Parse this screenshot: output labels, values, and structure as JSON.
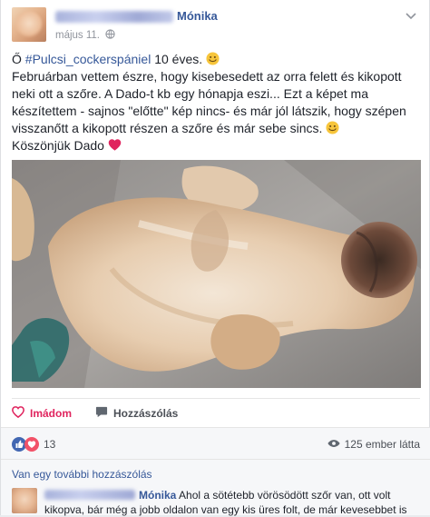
{
  "post": {
    "author": "Mónika",
    "date": "május 11.",
    "text": {
      "prefix": "Ő ",
      "hashtag": "#Pulcsi_cockerspániel",
      "after_hashtag": " 10 éves. ",
      "body": "Februárban vettem észre, hogy kisebesedett az orra felett és kikopott neki ott a szőre. A Dado-t kb egy hónapja eszi... Ezt a képet ma készítettem - sajnos \"előtte\" kép nincs- és már jól látszik, hogy szépen visszanőtt a kikopott részen a szőre és már sebe sincs. ",
      "thanks": "Köszönjük Dado "
    }
  },
  "actions": {
    "love_label": "Imádom",
    "comment_label": "Hozzászólás"
  },
  "reactions": {
    "count": "13",
    "seen": "125 ember látta"
  },
  "comments": {
    "more_label": "Van egy további hozzászólás",
    "first": {
      "author": "Mónika",
      "text": "Ahol a sötétebb vörösödött szőr van, ott volt kikopva, bár még a jobb oldalon van egy kis üres folt, de már kevesebbet is"
    }
  },
  "icons": {
    "like": "like-icon",
    "love": "heart-icon",
    "comment": "comment-icon",
    "eye": "eye-icon",
    "globe": "globe-icon"
  },
  "colors": {
    "link": "#365899",
    "love": "#e0245e",
    "like": "#4267b2"
  }
}
